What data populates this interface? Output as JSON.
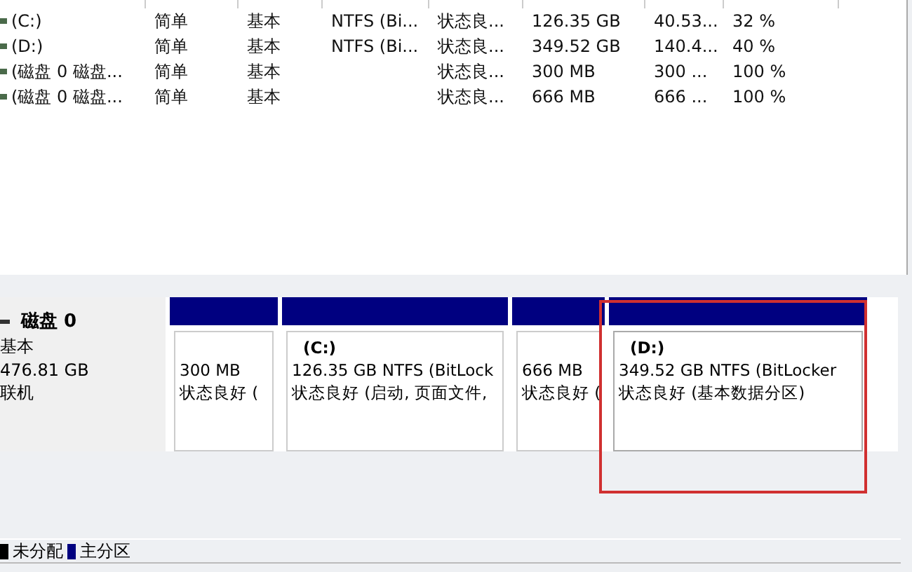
{
  "volumes": [
    {
      "name": "(C:)",
      "layout": "简单",
      "type": "基本",
      "filesystem": "NTFS (Bi...",
      "status": "状态良...",
      "capacity": "126.35 GB",
      "free": "40.53...",
      "percent": "32 %"
    },
    {
      "name": "(D:)",
      "layout": "简单",
      "type": "基本",
      "filesystem": "NTFS (Bi...",
      "status": "状态良...",
      "capacity": "349.52 GB",
      "free": "140.4...",
      "percent": "40 %"
    },
    {
      "name": "(磁盘 0 磁盘...",
      "layout": "简单",
      "type": "基本",
      "status": "状态良...",
      "capacity": "300 MB",
      "free": "300 ...",
      "percent": "100 %"
    },
    {
      "name": "(磁盘 0 磁盘...",
      "layout": "简单",
      "type": "基本",
      "status": "状态良...",
      "capacity": "666 MB",
      "free": "666 ...",
      "percent": "100 %"
    }
  ],
  "disk": {
    "title": "磁盘 0",
    "type": "基本",
    "size": "476.81 GB",
    "state": "联机",
    "partitions": [
      {
        "size": "300 MB",
        "status": "状态良好 (",
        "highlighted": false
      },
      {
        "label": "(C:)",
        "size": "126.35 GB NTFS (BitLock",
        "status": "状态良好 (启动, 页面文件,",
        "highlighted": false
      },
      {
        "size": "666 MB",
        "status": "状态良好 (",
        "highlighted": false
      },
      {
        "label": "(D:)",
        "size": "349.52 GB NTFS (BitLocker",
        "status": "状态良好 (基本数据分区)",
        "highlighted": true
      }
    ]
  },
  "legend": [
    {
      "label": "未分配",
      "color": "#000000"
    },
    {
      "label": "主分区",
      "color": "#000080"
    }
  ]
}
